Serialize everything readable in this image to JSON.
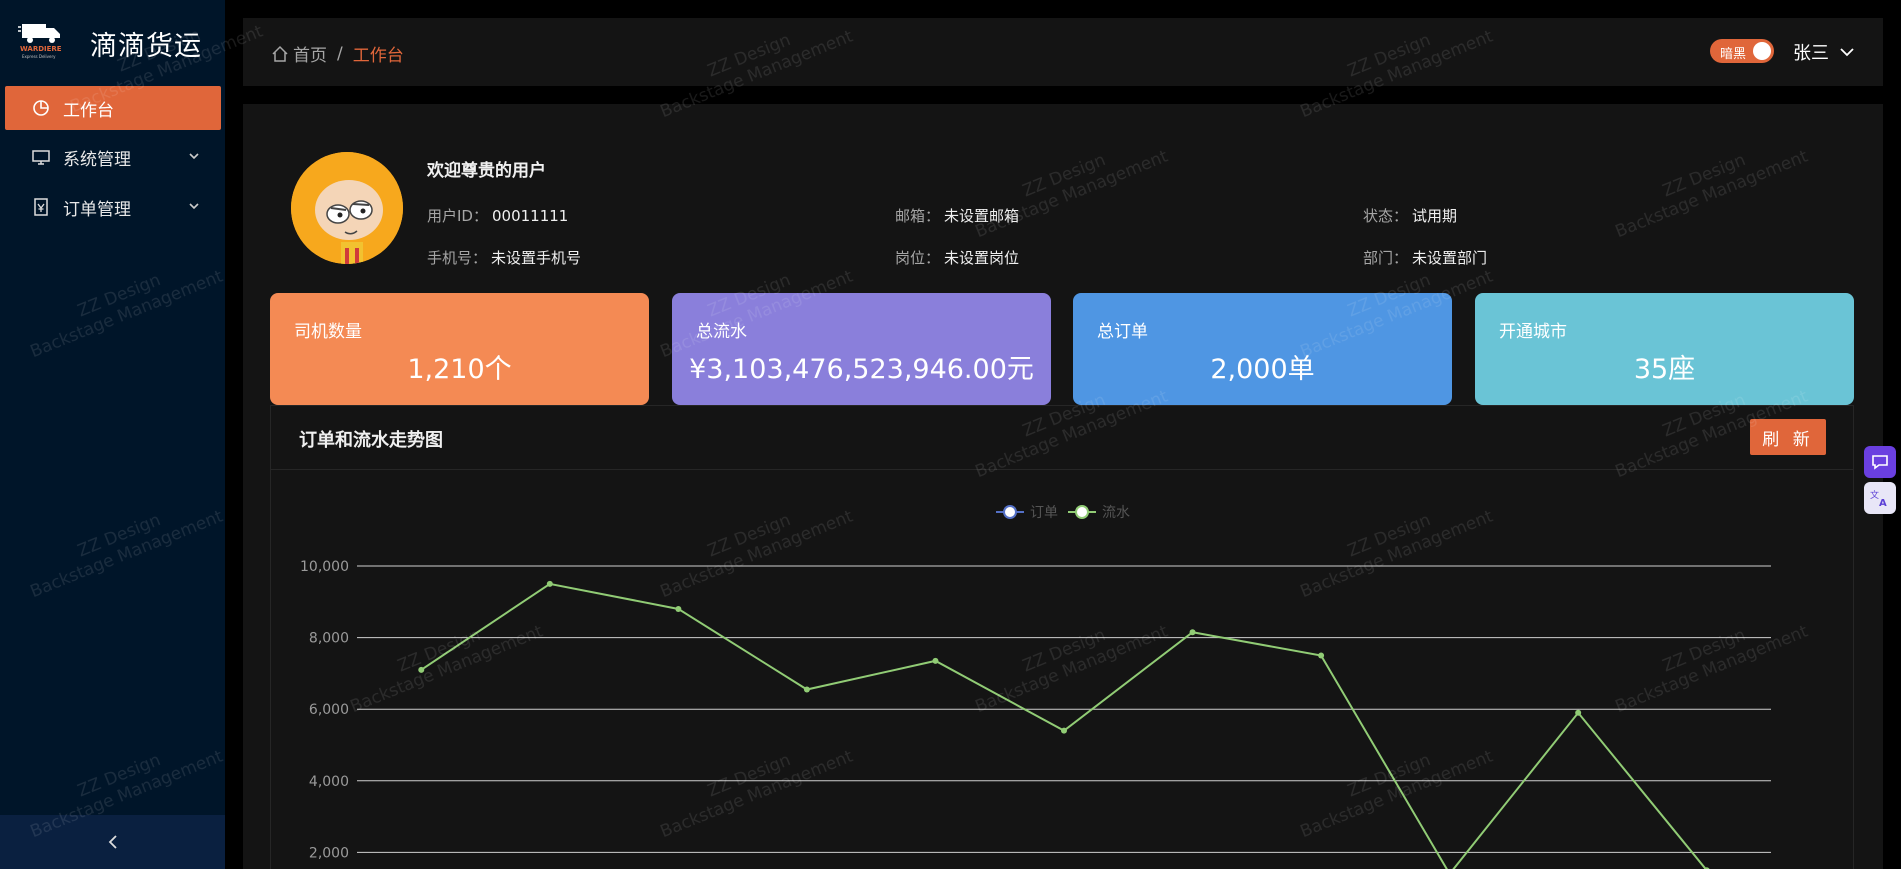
{
  "app": {
    "title": "滴滴货运",
    "logo_text": "WARDIERE",
    "logo_subtext": "Express Delivery"
  },
  "sidebar": {
    "items": [
      {
        "label": "工作台",
        "icon": "pie-chart-icon",
        "active": true
      },
      {
        "label": "系统管理",
        "icon": "monitor-icon",
        "has_children": true
      },
      {
        "label": "订单管理",
        "icon": "order-icon",
        "has_children": true
      }
    ],
    "collapse_icon": "chevron-left-icon"
  },
  "header": {
    "breadcrumb": {
      "home_label": "首页",
      "separator": "/",
      "current": "工作台"
    },
    "dark_toggle_label": "暗黑",
    "user_name": "张三"
  },
  "profile": {
    "welcome": "欢迎尊贵的用户",
    "user_id_label": "用户ID：",
    "user_id": "00011111",
    "email_label": "邮箱：",
    "email": "未设置邮箱",
    "status_label": "状态：",
    "status": "试用期",
    "phone_label": "手机号：",
    "phone": "未设置手机号",
    "position_label": "岗位：",
    "position": "未设置岗位",
    "dept_label": "部门：",
    "dept": "未设置部门"
  },
  "stats": [
    {
      "title": "司机数量",
      "value": "1,210个",
      "color": "#f48a54"
    },
    {
      "title": "总流水",
      "value": "¥3,103,476,523,946.00元",
      "color": "#8a7fdb"
    },
    {
      "title": "总订单",
      "value": "2,000单",
      "color": "#4f96e3"
    },
    {
      "title": "开通城市",
      "value": "35座",
      "color": "#6ac4d6"
    }
  ],
  "chart_panel": {
    "title": "订单和流水走势图",
    "refresh_label": "刷 新"
  },
  "chart_data": {
    "type": "line",
    "title": "",
    "xlabel": "",
    "ylabel": "",
    "ylim": [
      0,
      10000
    ],
    "yticks": [
      "10,000",
      "8,000",
      "6,000",
      "4,000",
      "2,000"
    ],
    "grid": true,
    "legend": "top-center",
    "series": [
      {
        "name": "订单",
        "color": "#5470c6",
        "values": []
      },
      {
        "name": "流水",
        "color": "#91cc75",
        "values": [
          7100,
          9500,
          8800,
          6550,
          7350,
          5400,
          8150,
          7500,
          1400,
          5900,
          1500
        ]
      }
    ]
  },
  "watermark": {
    "line1": "ZZ Design",
    "line2": "Backstage Management"
  }
}
